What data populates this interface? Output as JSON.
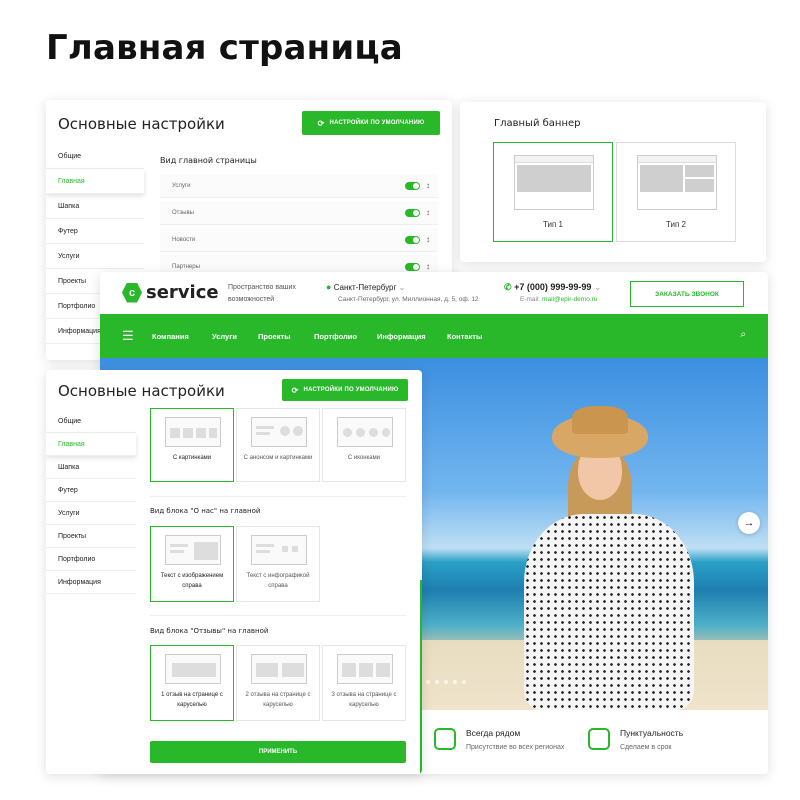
{
  "page_title": "Главная страница",
  "colors": {
    "accent": "#29b82a",
    "text": "#222222"
  },
  "settings_panel_top": {
    "title": "Основные настройки",
    "default_button": "Настройки по умолчанию",
    "sidebar": [
      "Общие",
      "Главная",
      "Шапка",
      "Футер",
      "Услуги",
      "Проекты",
      "Портфолио",
      "Информация"
    ],
    "active_item": "Главная",
    "section_title": "Вид главной страницы",
    "rows": [
      {
        "label": "Услуги",
        "enabled": true
      },
      {
        "label": "Отзывы",
        "enabled": true
      },
      {
        "label": "Новости",
        "enabled": true
      },
      {
        "label": "Партнеры",
        "enabled": true
      }
    ]
  },
  "banner_panel": {
    "title": "Главный баннер",
    "types": [
      "Тип 1",
      "Тип 2"
    ],
    "selected": "Тип 1"
  },
  "site": {
    "logo": "service",
    "tagline": "Пространство ваших возможностей",
    "city": "Санкт-Петербург",
    "address": "Санкт-Петербург, ул. Миллионная, д. 5, оф. 12",
    "phone": "+7 (000) 999-99-99",
    "email_label": "E-mail:",
    "email": "mail@epir-demo.ru",
    "callback_button": "Заказать звонок",
    "nav": [
      "Компания",
      "Услуги",
      "Проекты",
      "Портфолио",
      "Информация",
      "Контакты"
    ],
    "features": [
      {
        "title": "Всегда рядом",
        "subtitle": "Присутствие во всех регионах",
        "icon": "location-icon"
      },
      {
        "title": "Пунктуальность",
        "subtitle": "Сделаем в срок",
        "icon": "delivery-clock-icon"
      }
    ]
  },
  "settings_panel_bottom": {
    "title": "Основные настройки",
    "default_button": "Настройки по умолчанию",
    "sidebar": [
      "Общие",
      "Главная",
      "Шапка",
      "Футер",
      "Услуги",
      "Проекты",
      "Портфолио",
      "Информация"
    ],
    "active_item": "Главная",
    "services_options": [
      "С картинками",
      "С анонсом и картинками",
      "С иконками"
    ],
    "services_selected": "С картинками",
    "about_title": "Вид блока \"О нас\" на главной",
    "about_options": [
      "Текст с изображением справа",
      "Текст с инфографикой справа"
    ],
    "about_selected": "Текст с изображением справа",
    "reviews_title": "Вид блока \"Отзывы\" на главной",
    "reviews_options": [
      "1 отзыв на странице с каруселью",
      "2 отзыва на странице с каруселью",
      "3 отзыва на странице с каруселью"
    ],
    "reviews_selected": "1 отзыв на странице с каруселью",
    "apply_button": "Применить"
  }
}
